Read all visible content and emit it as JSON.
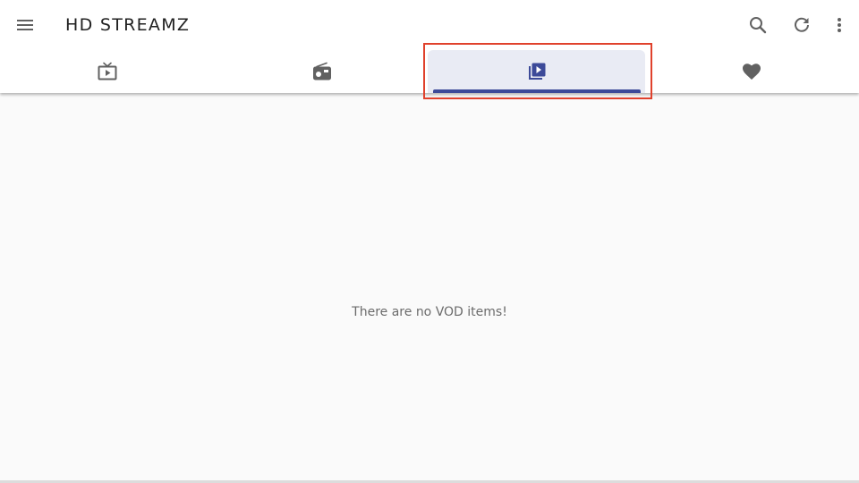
{
  "app": {
    "title": "HD STREAMZ"
  },
  "toolbar": {
    "menu_icon": "menu-icon",
    "search_icon": "search-icon",
    "refresh_icon": "refresh-icon",
    "more_icon": "more-vert-icon"
  },
  "tabs": [
    {
      "id": "live-tv",
      "icon": "tv-play-icon",
      "selected": false
    },
    {
      "id": "radio",
      "icon": "radio-icon",
      "selected": false
    },
    {
      "id": "vod",
      "icon": "video-library-icon",
      "selected": true
    },
    {
      "id": "favorites",
      "icon": "heart-icon",
      "selected": false
    }
  ],
  "main": {
    "empty_message": "There are no VOD items!"
  },
  "colors": {
    "accent": "#3c4a99",
    "selected_tab_bg": "#e9ebf4",
    "icon_gray": "#616161",
    "highlight": "#e0412c"
  }
}
